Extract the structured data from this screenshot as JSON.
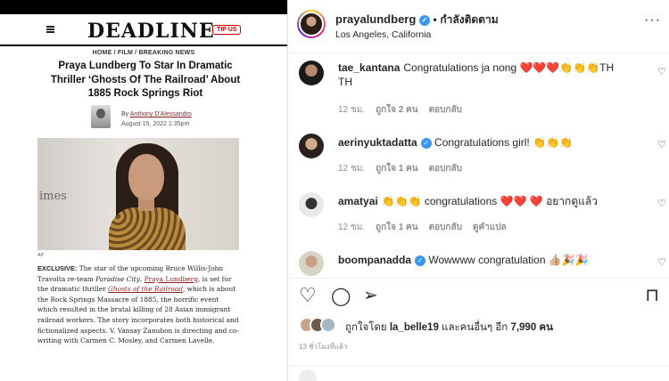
{
  "article": {
    "logo": "DEADLINE",
    "tip_us": "TIP US",
    "breadcrumb": "HOME / FILM / BREAKING NEWS",
    "headline": "Praya Lundberg To Star In Dramatic Thriller ‘Ghosts Of The Railroad’ About 1885 Rock Springs Riot",
    "by": "By ",
    "author": "Anthony D'Alessandro",
    "date": "August 15, 2022 1:35pm",
    "photo_watermark": "imes",
    "photo_credit": "AP",
    "body": {
      "lead": "EXCLUSIVE:",
      "p1": " The star of the upcoming Bruce Willis-John Travolta re-team ",
      "title1": "Paradise City",
      "p2": ", ",
      "name": "Praya Lundberg",
      "p3": ", is set for the dramatic thriller ",
      "title2": "Ghosts of the Railroad",
      "p4": ", which is about the Rock Springs Massacre of 1885, the horrific event which resulted in the brutal killing of 28 Asian immigrant railroad workers. The story incorporates both historical and fictionalized aspects. V. Vansay Zanubon is directing and co-writing with Carmen C. Mosley, and Carmen Lavelle."
    }
  },
  "post": {
    "username": "prayalundberg",
    "dot": "•",
    "follow_state": "กำลังติดตาม",
    "location": "Los Angeles, California",
    "more": "···",
    "comments": [
      {
        "user": "tae_kantana",
        "text": "Congratulations ja nong ❤️❤️❤️👏👏👏TH",
        "text_cont": "TH",
        "time": "12 ชม.",
        "likes": "ถูกใจ 2 คน",
        "reply": "ตอบกลับ",
        "translate": ""
      },
      {
        "user": "aerinyuktadatta",
        "text": "Congratulations girl! 👏👏👏",
        "time": "12 ชม.",
        "likes": "ถูกใจ 1 คน",
        "reply": "ตอบกลับ",
        "translate": ""
      },
      {
        "user": "amatyai",
        "text": "👏👏👏 congratulations ❤️❤️ ❤️ อยากดูแล้ว",
        "time": "12 ชม.",
        "likes": "ถูกใจ 1 คน",
        "reply": "ตอบกลับ",
        "translate": "ดูคำแปล"
      },
      {
        "user": "boompanadda",
        "text": "Wowwww congratulation 👍🏼🎉🎉",
        "time": "",
        "likes": "",
        "reply": "",
        "translate": ""
      }
    ],
    "liked_by_prefix": "ถูกใจโดย ",
    "liked_by_user": "la_belle19",
    "liked_by_suffix": " และคนอื่นๆ อีก ",
    "liked_count": "7,990 คน",
    "time_ago": "13 ชั่วโมงที่แล้ว",
    "icons": [
      "heart-icon",
      "comment-icon",
      "share-icon",
      "bookmark-icon",
      "verified-icon",
      "more-icon"
    ],
    "colors": {
      "verified": "#3897f0",
      "text": "#262626",
      "muted": "#8e8e8e",
      "hearts": "#ed4956"
    }
  }
}
